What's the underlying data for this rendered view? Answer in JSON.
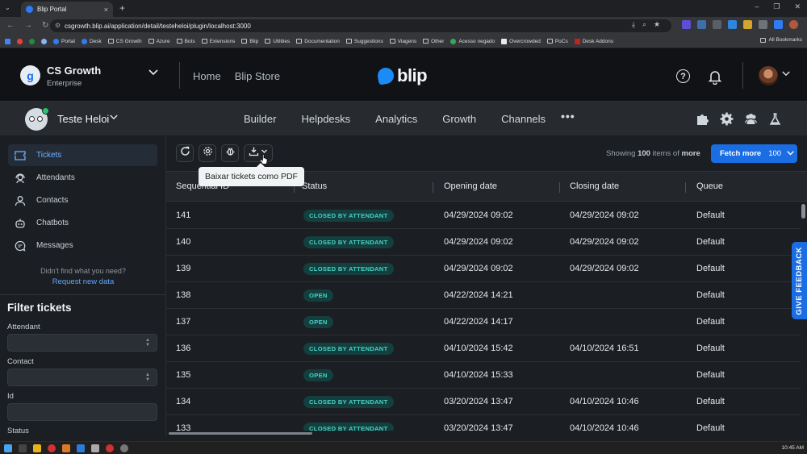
{
  "browser": {
    "tab_title": "Blip Portal",
    "tab_close": "×",
    "new_tab": "+",
    "url": "csgrowth.blip.ai/application/detail/testeheloi/plugin/localhost:3000",
    "window_controls": [
      "–",
      "❐",
      "✕"
    ],
    "bookmarks": [
      "Portal",
      "Desk",
      "CS Growth",
      "Azure",
      "Bots",
      "Extensions",
      "Blip",
      "Utilities",
      "Documentation",
      "Suggestions",
      "Viagens",
      "Other",
      "Acesso negado",
      "Overcrowded",
      "PoCs",
      "Desk Addons"
    ],
    "all_bookmarks": "All Bookmarks"
  },
  "header": {
    "org_initial": "g",
    "org_name": "CS Growth",
    "org_plan": "Enterprise",
    "nav": [
      "Home",
      "Blip Store"
    ],
    "brand": "blip",
    "help": "?"
  },
  "subheader": {
    "bot_name": "Teste Heloi",
    "nav": [
      "Builder",
      "Helpdesks",
      "Analytics",
      "Growth",
      "Channels"
    ],
    "more": "•••"
  },
  "sidebar": {
    "items": [
      {
        "label": "Tickets",
        "active": true
      },
      {
        "label": "Attendants",
        "active": false
      },
      {
        "label": "Contacts",
        "active": false
      },
      {
        "label": "Chatbots",
        "active": false
      },
      {
        "label": "Messages",
        "active": false
      }
    ],
    "note": "Didn't find what you need?",
    "link": "Request new data",
    "filter_title": "Filter tickets",
    "filters": [
      "Attendant",
      "Contact",
      "Id",
      "Status"
    ]
  },
  "toolbar": {
    "tooltip": "Baixar tickets como PDF",
    "showing_prefix": "Showing ",
    "showing_count": "100",
    "showing_mid": " items of ",
    "showing_more": "more",
    "fetch_label": "Fetch more",
    "fetch_count": "100"
  },
  "table": {
    "columns": [
      "Sequential ID",
      "Status",
      "Opening date",
      "Closing date",
      "Queue"
    ],
    "rows": [
      {
        "id": "141",
        "status": "CLOSED BY ATTENDANT",
        "opening": "04/29/2024 09:02",
        "closing": "04/29/2024 09:02",
        "queue": "Default"
      },
      {
        "id": "140",
        "status": "CLOSED BY ATTENDANT",
        "opening": "04/29/2024 09:02",
        "closing": "04/29/2024 09:02",
        "queue": "Default"
      },
      {
        "id": "139",
        "status": "CLOSED BY ATTENDANT",
        "opening": "04/29/2024 09:02",
        "closing": "04/29/2024 09:02",
        "queue": "Default"
      },
      {
        "id": "138",
        "status": "OPEN",
        "opening": "04/22/2024 14:21",
        "closing": "",
        "queue": "Default"
      },
      {
        "id": "137",
        "status": "OPEN",
        "opening": "04/22/2024 14:17",
        "closing": "",
        "queue": "Default"
      },
      {
        "id": "136",
        "status": "CLOSED BY ATTENDANT",
        "opening": "04/10/2024 15:42",
        "closing": "04/10/2024 16:51",
        "queue": "Default"
      },
      {
        "id": "135",
        "status": "OPEN",
        "opening": "04/10/2024 15:33",
        "closing": "",
        "queue": "Default"
      },
      {
        "id": "134",
        "status": "CLOSED BY ATTENDANT",
        "opening": "03/20/2024 13:47",
        "closing": "04/10/2024 10:46",
        "queue": "Default"
      },
      {
        "id": "133",
        "status": "CLOSED BY ATTENDANT",
        "opening": "03/20/2024 13:47",
        "closing": "04/10/2024 10:46",
        "queue": "Default"
      }
    ]
  },
  "feedback": "GIVE FEEDBACK",
  "taskbar": {
    "time": "10:45 AM"
  },
  "icons": {
    "refresh": "refresh-icon",
    "settings": "gear-icon",
    "bug": "bug-icon",
    "download": "download-icon",
    "help": "help-icon",
    "bell": "bell-icon",
    "puzzle": "puzzle-icon",
    "team": "team-icon",
    "flask": "flask-icon"
  },
  "colors": {
    "accent": "#1a6de3",
    "badge_bg": "#13403f",
    "badge_text": "#4ad0c3",
    "link": "#5fa8ff"
  }
}
